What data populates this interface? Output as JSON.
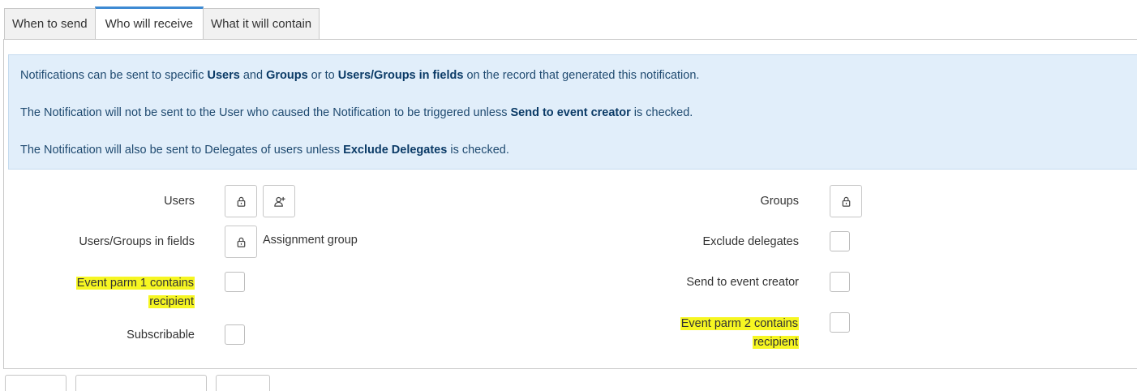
{
  "tabs": [
    {
      "label": "When to send",
      "active": false
    },
    {
      "label": "Who will receive",
      "active": true
    },
    {
      "label": "What it will contain",
      "active": false
    }
  ],
  "info": {
    "line1": {
      "pre": "Notifications can be sent to specific ",
      "b1": "Users",
      "mid1": " and ",
      "b2": "Groups",
      "mid2": " or to ",
      "b3": "Users/Groups in fields",
      "post": " on the record that generated this notification."
    },
    "line2": {
      "pre": "The Notification will not be sent to the User who caused the Notification to be triggered unless ",
      "b1": "Send to event creator",
      "post": " is checked."
    },
    "line3": {
      "pre": "The Notification will also be sent to Delegates of users unless ",
      "b1": "Exclude Delegates",
      "post": " is checked."
    }
  },
  "form": {
    "users_label": "Users",
    "users_groups_label": "Users/Groups in fields",
    "users_groups_value": "Assignment group",
    "event_parm1_line1": "Event parm 1 contains",
    "event_parm1_line2": "recipient",
    "subscribable_label": "Subscribable",
    "groups_label": "Groups",
    "exclude_delegates_label": "Exclude delegates",
    "send_to_creator_label": "Send to event creator",
    "event_parm2_line1": "Event parm 2 contains",
    "event_parm2_line2": "recipient"
  },
  "colors": {
    "accent": "#3d8ad3",
    "info_background": "#e1eefa",
    "highlight": "#f6f622"
  },
  "icons": [
    "lock-icon",
    "add-user-icon"
  ]
}
